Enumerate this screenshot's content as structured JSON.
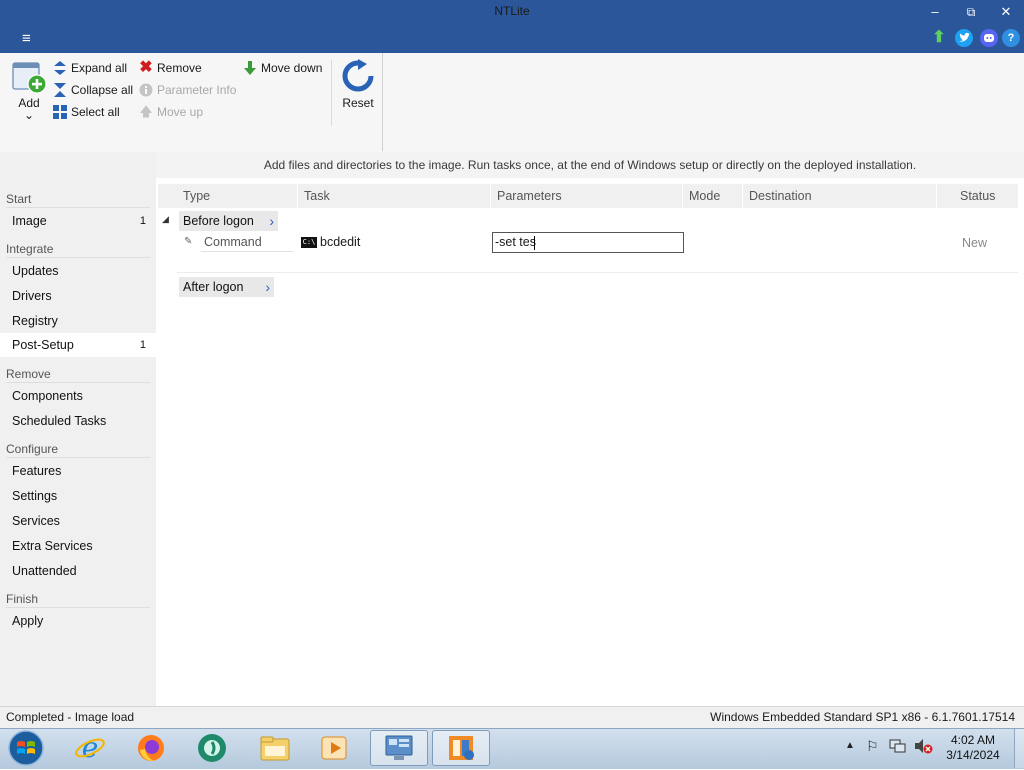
{
  "window": {
    "title": "NTLite"
  },
  "window_controls": {
    "minimize": "–",
    "maximize": "⧉",
    "close": "✕"
  },
  "ribbon": {
    "add_label": "Add",
    "add_dropdown": "⌄",
    "expand_all": "Expand all",
    "collapse_all": "Collapse all",
    "select_all": "Select all",
    "remove": "Remove",
    "parameter_info": "Parameter Info",
    "move_up": "Move up",
    "move_down": "Move down",
    "reset": "Reset"
  },
  "info_text": "Add files and directories to the image. Run tasks once, at the end of Windows setup or directly on the deployed installation.",
  "sidebar": {
    "groups": {
      "start": "Start",
      "integrate": "Integrate",
      "remove": "Remove",
      "configure": "Configure",
      "finish": "Finish"
    },
    "items": {
      "image": {
        "label": "Image",
        "count": "1"
      },
      "updates": {
        "label": "Updates"
      },
      "drivers": {
        "label": "Drivers"
      },
      "registry": {
        "label": "Registry"
      },
      "post_setup": {
        "label": "Post-Setup",
        "count": "1"
      },
      "components": {
        "label": "Components"
      },
      "scheduled_tasks": {
        "label": "Scheduled Tasks"
      },
      "features": {
        "label": "Features"
      },
      "settings": {
        "label": "Settings"
      },
      "services": {
        "label": "Services"
      },
      "extra_services": {
        "label": "Extra Services"
      },
      "unattended": {
        "label": "Unattended"
      },
      "apply": {
        "label": "Apply"
      }
    }
  },
  "table": {
    "columns": {
      "type": "Type",
      "task": "Task",
      "parameters": "Parameters",
      "mode": "Mode",
      "destination": "Destination",
      "status": "Status"
    },
    "before_logon": "Before logon",
    "after_logon": "After logon",
    "row": {
      "type": "Command",
      "task": "bcdedit",
      "task_icon": "C:\\",
      "parameters": "-set tes",
      "status": "New"
    }
  },
  "statusbar": {
    "left": "Completed - Image load",
    "right": "Windows Embedded Standard SP1 x86 - 6.1.7601.17514"
  },
  "taskbar": {
    "time": "4:02 AM",
    "date": "3/14/2024"
  },
  "colors": {
    "titlebar": "#2b579a",
    "accent": "#2a62b5",
    "remove_red": "#d01e1e",
    "move_down_green": "#3b9a3b"
  }
}
